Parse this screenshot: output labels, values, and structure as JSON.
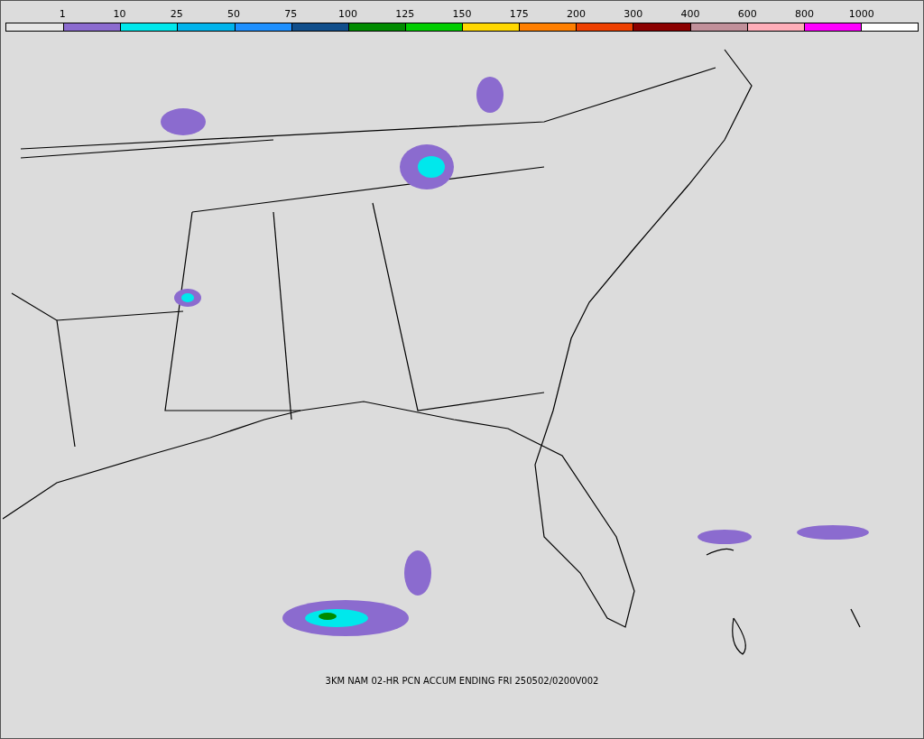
{
  "legend": {
    "labels": [
      "1",
      "10",
      "25",
      "50",
      "75",
      "100",
      "125",
      "150",
      "175",
      "200",
      "300",
      "400",
      "600",
      "800",
      "1000"
    ],
    "bins": [
      {
        "color": "#e6e6e6"
      },
      {
        "color": "#8b6bcf"
      },
      {
        "color": "#00e8ec"
      },
      {
        "color": "#00b3ec"
      },
      {
        "color": "#1e90ff"
      },
      {
        "color": "#104e8b"
      },
      {
        "color": "#008b00"
      },
      {
        "color": "#00cd00"
      },
      {
        "color": "#ffd700"
      },
      {
        "color": "#ff7f00"
      },
      {
        "color": "#ee4000"
      },
      {
        "color": "#8b0000"
      },
      {
        "color": "#c1909a"
      },
      {
        "color": "#ffaeb9"
      },
      {
        "color": "#ff00ff"
      },
      {
        "color": "#ffffff"
      }
    ]
  },
  "caption": "3KM NAM 02-HR PCN ACCUM ENDING FRI 250502/0200V002"
}
